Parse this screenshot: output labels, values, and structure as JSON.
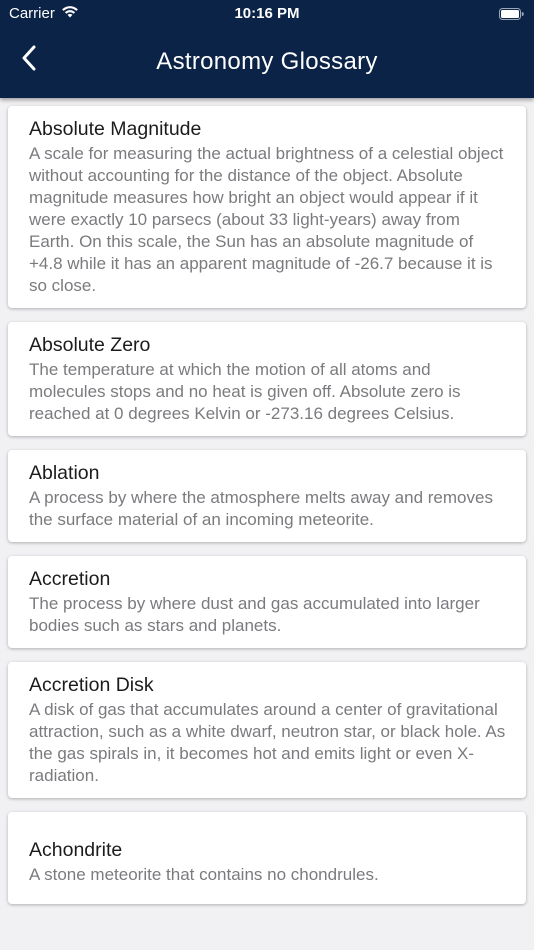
{
  "status_bar": {
    "carrier": "Carrier",
    "time": "10:16 PM"
  },
  "header": {
    "title": "Astronomy Glossary",
    "back_icon": "chevron-left-icon",
    "background_color": "#0b2347"
  },
  "entries": [
    {
      "term": "Absolute Magnitude",
      "definition": "A scale for measuring the actual brightness of a celestial object without accounting for the distance of the object. Absolute magnitude measures how bright an object would appear if it were exactly 10 parsecs (about 33 light-years) away from Earth. On this scale, the Sun has an absolute magnitude of +4.8 while it has an apparent magnitude of -26.7 because it is so close."
    },
    {
      "term": "Absolute Zero",
      "definition": "The temperature at which the motion of all atoms and molecules stops and no heat is given off. Absolute zero is reached at 0 degrees Kelvin or -273.16 degrees Celsius."
    },
    {
      "term": "Ablation",
      "definition": "A process by where the atmosphere melts away and removes the surface material of an incoming meteorite."
    },
    {
      "term": "Accretion",
      "definition": "The process by where dust and gas accumulated into larger bodies such as stars and planets."
    },
    {
      "term": "Accretion Disk",
      "definition": "A disk of gas that accumulates around a center of gravitational attraction, such as a white dwarf, neutron star, or black hole. As the gas spirals in, it becomes hot and emits light or even X-radiation."
    },
    {
      "term": "Achondrite",
      "definition": "A stone meteorite that contains no chondrules."
    }
  ]
}
